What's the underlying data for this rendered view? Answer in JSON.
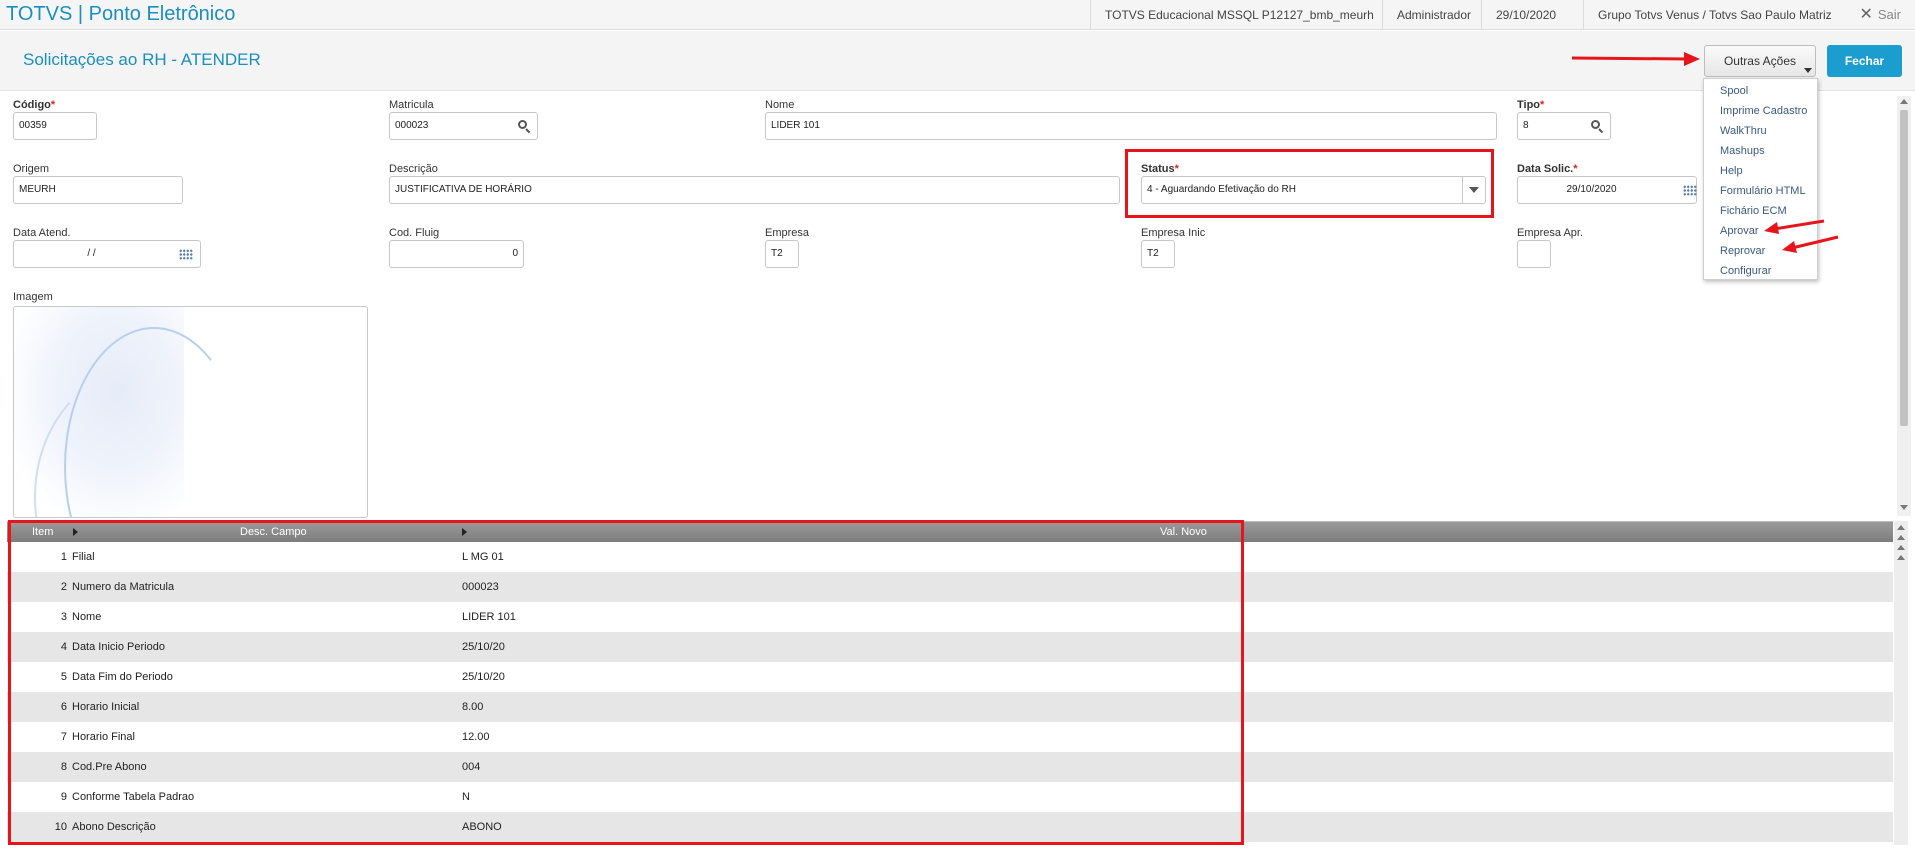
{
  "topbar": {
    "app_title": "TOTVS | Ponto Eletrônico",
    "environment": "TOTVS Educacional MSSQL P12127_bmb_meurh",
    "user": "Administrador",
    "date": "29/10/2020",
    "company": "Grupo Totvs Venus / Totvs Sao Paulo Matriz",
    "logout_label": "Sair"
  },
  "header": {
    "page_title": "Solicitações ao RH - ATENDER",
    "outras_acoes_label": "Outras Ações",
    "fechar_label": "Fechar"
  },
  "form": {
    "codigo": {
      "label": "Código",
      "value": "00359"
    },
    "matricula": {
      "label": "Matricula",
      "value": "000023"
    },
    "nome": {
      "label": "Nome",
      "value": "LIDER 101"
    },
    "tipo": {
      "label": "Tipo",
      "value": "8"
    },
    "origem": {
      "label": "Origem",
      "value": "MEURH"
    },
    "descricao": {
      "label": "Descrição",
      "value": "JUSTIFICATIVA DE HORÁRIO"
    },
    "status": {
      "label": "Status",
      "value": "4 - Aguardando Efetivação do RH"
    },
    "data_solic": {
      "label": "Data Solic.",
      "value": "29/10/2020"
    },
    "data_atend": {
      "label": "Data Atend.",
      "value": "/  /"
    },
    "cod_fluig": {
      "label": "Cod. Fluig",
      "value": "0"
    },
    "empresa": {
      "label": "Empresa",
      "value": "T2"
    },
    "empresa_inic": {
      "label": "Empresa Inic",
      "value": "T2"
    },
    "empresa_apr": {
      "label": "Empresa Apr.",
      "value": ""
    },
    "imagem": {
      "label": "Imagem"
    }
  },
  "grid": {
    "columns": [
      "Item",
      "Desc. Campo",
      "Val. Novo"
    ],
    "rows": [
      {
        "item": "1",
        "desc": "Filial",
        "val": "L MG 01"
      },
      {
        "item": "2",
        "desc": "Numero da Matricula",
        "val": "000023"
      },
      {
        "item": "3",
        "desc": "Nome",
        "val": "LIDER 101"
      },
      {
        "item": "4",
        "desc": "Data Inicio Periodo",
        "val": "25/10/20"
      },
      {
        "item": "5",
        "desc": "Data Fim do Periodo",
        "val": "25/10/20"
      },
      {
        "item": "6",
        "desc": "Horario Inicial",
        "val": "8.00"
      },
      {
        "item": "7",
        "desc": "Horario Final",
        "val": "12.00"
      },
      {
        "item": "8",
        "desc": "Cod.Pre Abono",
        "val": "004"
      },
      {
        "item": "9",
        "desc": "Conforme Tabela Padrao",
        "val": "N"
      },
      {
        "item": "10",
        "desc": "Abono Descrição",
        "val": "ABONO"
      }
    ]
  },
  "menu": {
    "items": [
      "Spool",
      "Imprime Cadastro",
      "WalkThru",
      "Mashups",
      "Help",
      "Formulário HTML",
      "Fichário ECM",
      "Aprovar",
      "Reprovar",
      "Configurar"
    ]
  },
  "colors": {
    "brand": "#1a8fbf",
    "primary_button": "#1b9dd0",
    "annotation_red": "#e8141c",
    "required": "#e02020"
  }
}
